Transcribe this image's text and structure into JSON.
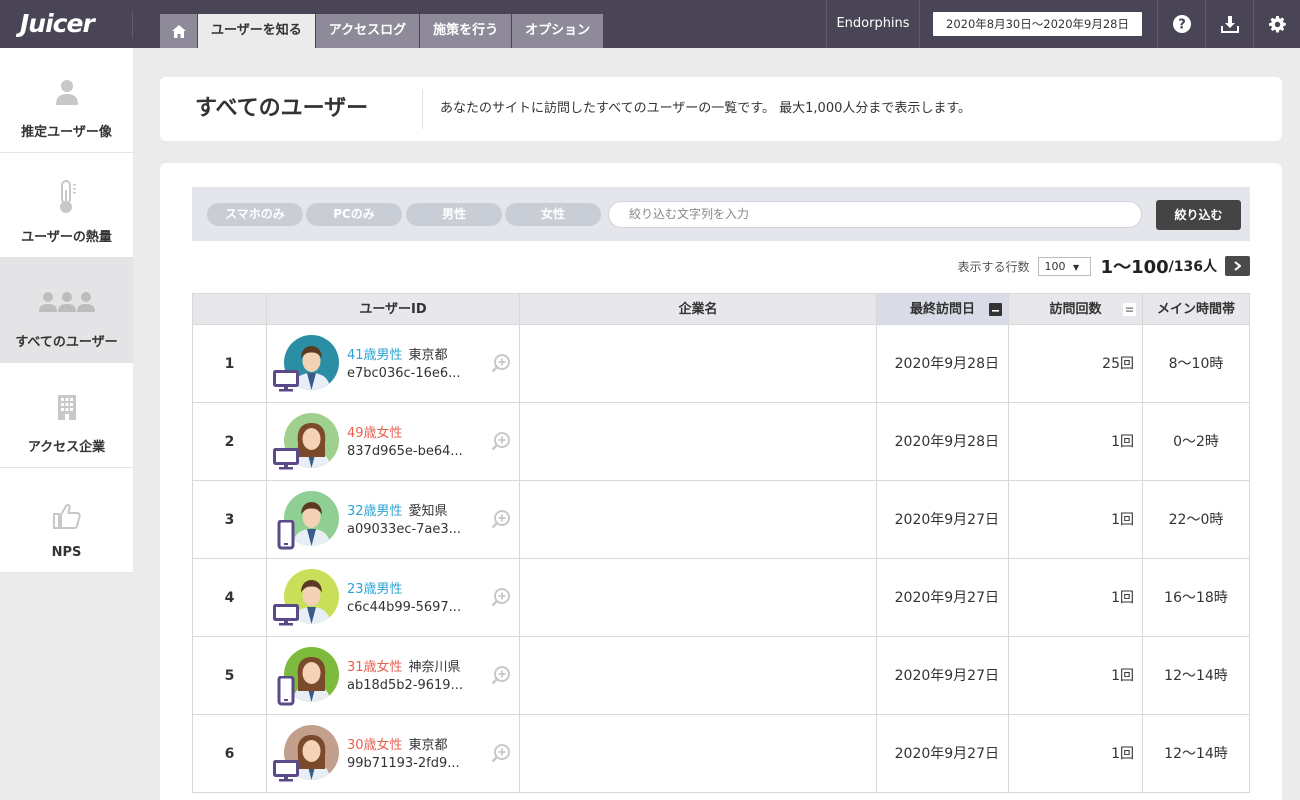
{
  "app": {
    "logo": "Juicer"
  },
  "nav": {
    "home_icon": "home-icon",
    "items": [
      {
        "label": "ユーザーを知る",
        "active": true
      },
      {
        "label": "アクセスログ",
        "active": false
      },
      {
        "label": "施策を行う",
        "active": false
      },
      {
        "label": "オプション",
        "active": false
      }
    ]
  },
  "topbar": {
    "site": "Endorphins",
    "date_range": "2020年8月30日〜2020年9月28日",
    "icons": [
      "help-icon",
      "download-icon",
      "settings-icon"
    ]
  },
  "sidebar": {
    "items": [
      {
        "label": "推定ユーザー像",
        "icon": "person-icon",
        "active": false
      },
      {
        "label": "ユーザーの熱量",
        "icon": "thermometer-icon",
        "active": false
      },
      {
        "label": "すべてのユーザー",
        "icon": "users-icon",
        "active": true
      },
      {
        "label": "アクセス企業",
        "icon": "building-icon",
        "active": false
      },
      {
        "label": "NPS",
        "icon": "thumbs-up-icon",
        "active": false
      }
    ]
  },
  "header": {
    "title": "すべてのユーザー",
    "description": "あなたのサイトに訪問したすべてのユーザーの一覧です。 最大1,000人分まで表示します。"
  },
  "filters": {
    "chips": [
      "スマホのみ",
      "PCのみ",
      "男性",
      "女性"
    ],
    "search_placeholder": "絞り込む文字列を入力",
    "button": "絞り込む"
  },
  "pager": {
    "rows_label": "表示する行数",
    "rows_value": "100",
    "range": "1〜100",
    "total": "/136人"
  },
  "table": {
    "columns": [
      "",
      "ユーザーID",
      "企業名",
      "最終訪問日",
      "訪問回数",
      "メイン時間帯"
    ],
    "rows": [
      {
        "no": "1",
        "age": "41歳男性",
        "gender": "m",
        "pref": "東京都",
        "id": "e7bc036c-16e6...",
        "company": "",
        "date": "2020年9月28日",
        "visits": "25回",
        "time": "8〜10時",
        "device": "pc",
        "avatar_color": "#2b8ea5"
      },
      {
        "no": "2",
        "age": "49歳女性",
        "gender": "f",
        "pref": "",
        "id": "837d965e-be64...",
        "company": "",
        "date": "2020年9月28日",
        "visits": "1回",
        "time": "0〜2時",
        "device": "pc",
        "avatar_color": "#9fd08e"
      },
      {
        "no": "3",
        "age": "32歳男性",
        "gender": "m",
        "pref": "愛知県",
        "id": "a09033ec-7ae3...",
        "company": "",
        "date": "2020年9月27日",
        "visits": "1回",
        "time": "22〜0時",
        "device": "sp",
        "avatar_color": "#8fcf93"
      },
      {
        "no": "4",
        "age": "23歳男性",
        "gender": "m",
        "pref": "",
        "id": "c6c44b99-5697...",
        "company": "",
        "date": "2020年9月27日",
        "visits": "1回",
        "time": "16〜18時",
        "device": "pc",
        "avatar_color": "#c9df5a"
      },
      {
        "no": "5",
        "age": "31歳女性",
        "gender": "f",
        "pref": "神奈川県",
        "id": "ab18d5b2-9619...",
        "company": "",
        "date": "2020年9月27日",
        "visits": "1回",
        "time": "12〜14時",
        "device": "sp",
        "avatar_color": "#7dbb3d"
      },
      {
        "no": "6",
        "age": "30歳女性",
        "gender": "f",
        "pref": "東京都",
        "id": "99b71193-2fd9...",
        "company": "",
        "date": "2020年9月27日",
        "visits": "1回",
        "time": "12〜14時",
        "device": "pc",
        "avatar_color": "#c2a08c"
      }
    ]
  }
}
